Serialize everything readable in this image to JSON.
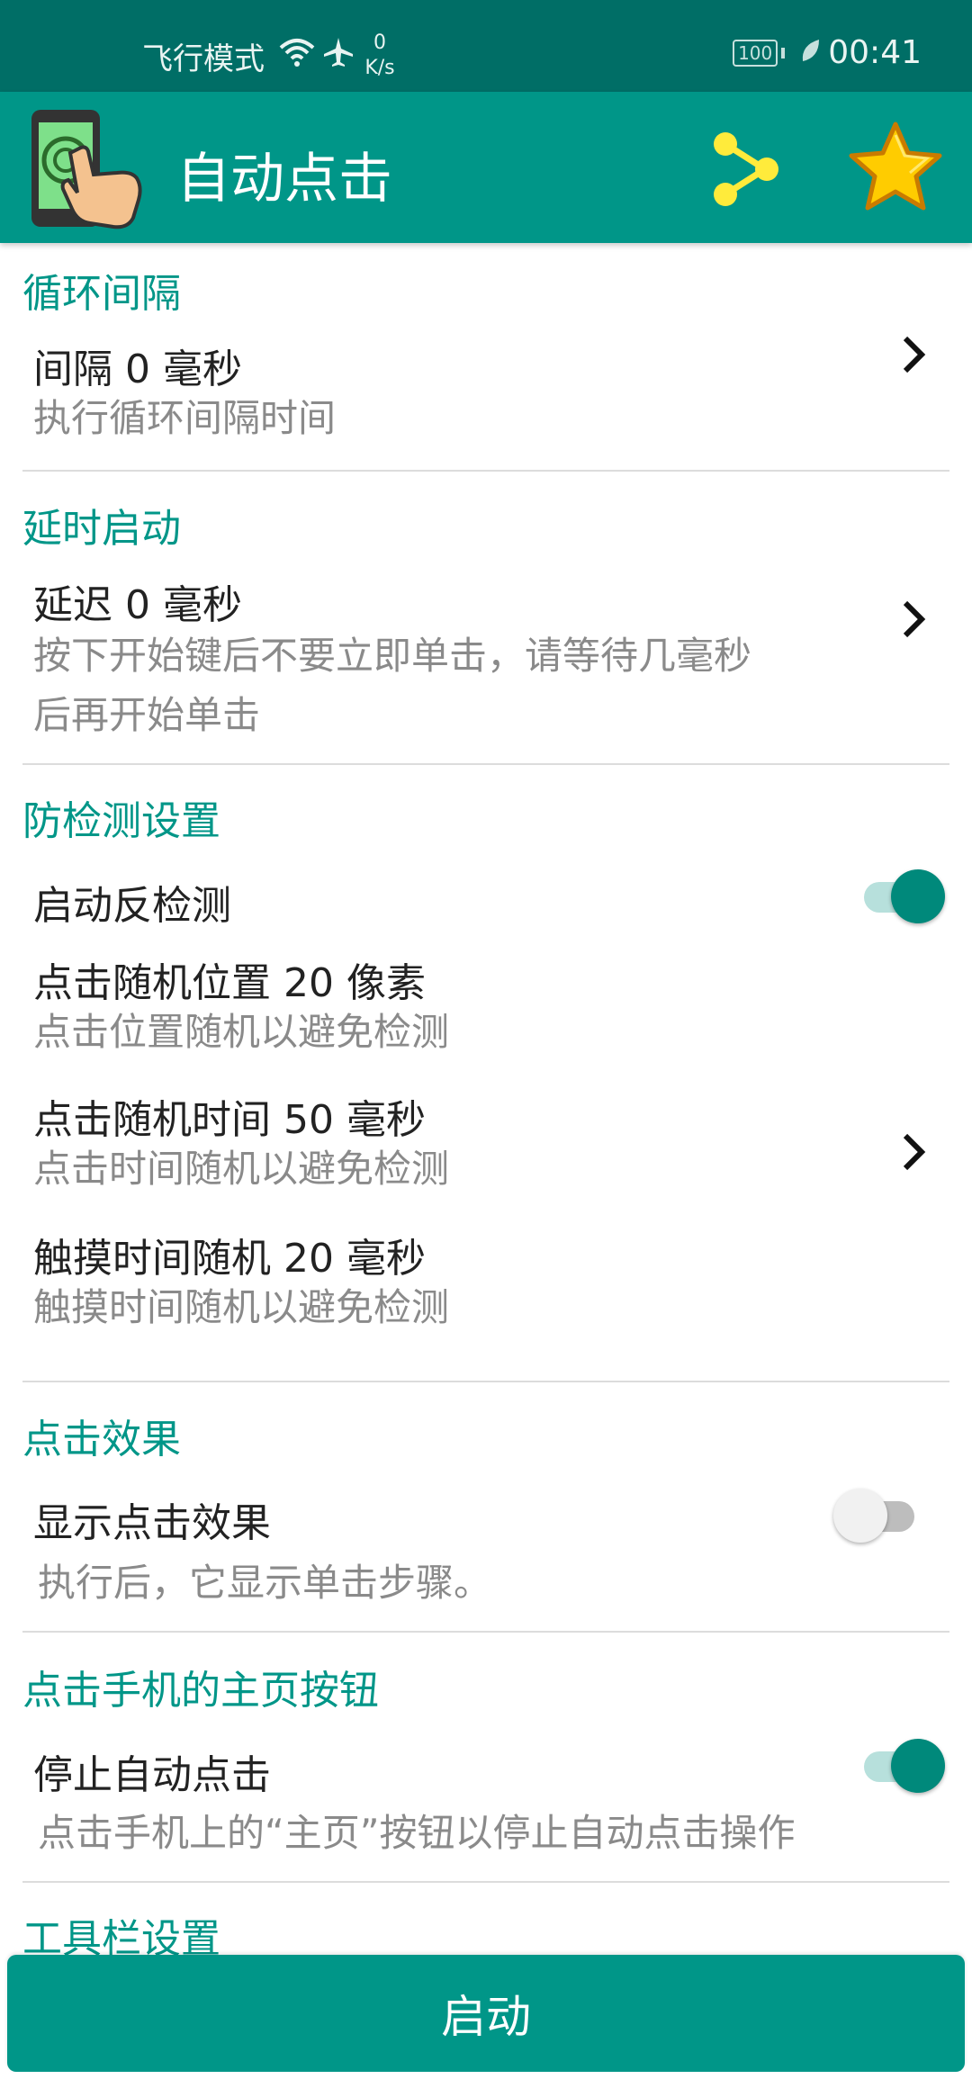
{
  "status_bar": {
    "mode": "飞行模式",
    "net_speed_value": "0",
    "net_speed_unit": "K/s",
    "battery": "100",
    "time": "00:41",
    "icons": [
      "wifi-icon",
      "airplane-icon",
      "battery-icon",
      "leaf-icon"
    ]
  },
  "app_bar": {
    "title": "自动点击",
    "icons": [
      "app-logo-icon",
      "share-icon",
      "star-icon"
    ]
  },
  "sections": {
    "interval": {
      "title": "循环间隔",
      "item_title": "间隔 0 毫秒",
      "item_sub": "执行循环间隔时间"
    },
    "delay": {
      "title": "延时启动",
      "item_title": "延迟 0 毫秒",
      "item_sub_line1": "按下开始键后不要立即单击，请等待几毫秒",
      "item_sub_line2": "后再开始单击"
    },
    "anti_detect": {
      "title": "防检测设置",
      "toggle_label": "启动反检测",
      "toggle_on": true,
      "pos_title": "点击随机位置 20 像素",
      "pos_sub": "点击位置随机以避免检测",
      "time_title": "点击随机时间 50 毫秒",
      "time_sub": "点击时间随机以避免检测",
      "touch_title": "触摸时间随机 20 毫秒",
      "touch_sub": "触摸时间随机以避免检测"
    },
    "effect": {
      "title": "点击效果",
      "toggle_label": "显示点击效果",
      "toggle_on": false,
      "sub": "执行后，它显示单击步骤。"
    },
    "home": {
      "title": "点击手机的主页按钮",
      "toggle_label": "停止自动点击",
      "toggle_on": true,
      "sub": "点击手机上的“主页”按钮以停止自动点击操作"
    },
    "toolbar": {
      "title": "工具栏设置"
    }
  },
  "bottom": {
    "start_label": "启动"
  },
  "colors": {
    "status_bar": "#006e66",
    "primary": "#009688",
    "accent_text": "#009688",
    "switch_on": "#00897b"
  }
}
